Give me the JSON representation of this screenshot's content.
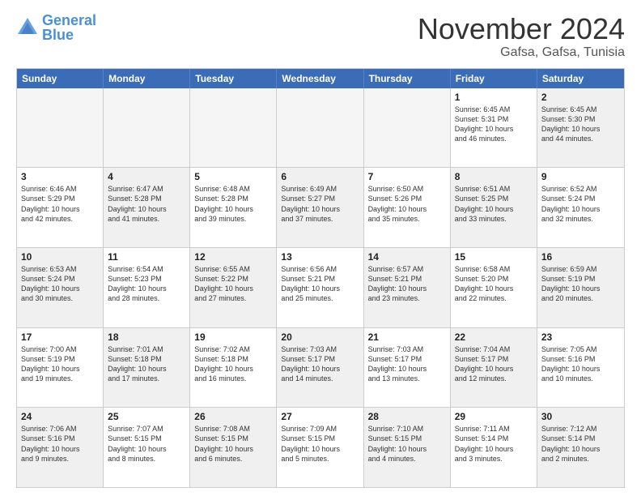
{
  "logo": {
    "line1": "General",
    "line2": "Blue"
  },
  "title": "November 2024",
  "location": "Gafsa, Gafsa, Tunisia",
  "days_of_week": [
    "Sunday",
    "Monday",
    "Tuesday",
    "Wednesday",
    "Thursday",
    "Friday",
    "Saturday"
  ],
  "rows": [
    [
      {
        "day": "",
        "empty": true
      },
      {
        "day": "",
        "empty": true
      },
      {
        "day": "",
        "empty": true
      },
      {
        "day": "",
        "empty": true
      },
      {
        "day": "",
        "empty": true
      },
      {
        "day": "1",
        "info": "Sunrise: 6:45 AM\nSunset: 5:31 PM\nDaylight: 10 hours\nand 46 minutes."
      },
      {
        "day": "2",
        "info": "Sunrise: 6:45 AM\nSunset: 5:30 PM\nDaylight: 10 hours\nand 44 minutes.",
        "shaded": true
      }
    ],
    [
      {
        "day": "3",
        "info": "Sunrise: 6:46 AM\nSunset: 5:29 PM\nDaylight: 10 hours\nand 42 minutes."
      },
      {
        "day": "4",
        "info": "Sunrise: 6:47 AM\nSunset: 5:28 PM\nDaylight: 10 hours\nand 41 minutes.",
        "shaded": true
      },
      {
        "day": "5",
        "info": "Sunrise: 6:48 AM\nSunset: 5:28 PM\nDaylight: 10 hours\nand 39 minutes."
      },
      {
        "day": "6",
        "info": "Sunrise: 6:49 AM\nSunset: 5:27 PM\nDaylight: 10 hours\nand 37 minutes.",
        "shaded": true
      },
      {
        "day": "7",
        "info": "Sunrise: 6:50 AM\nSunset: 5:26 PM\nDaylight: 10 hours\nand 35 minutes."
      },
      {
        "day": "8",
        "info": "Sunrise: 6:51 AM\nSunset: 5:25 PM\nDaylight: 10 hours\nand 33 minutes.",
        "shaded": true
      },
      {
        "day": "9",
        "info": "Sunrise: 6:52 AM\nSunset: 5:24 PM\nDaylight: 10 hours\nand 32 minutes."
      }
    ],
    [
      {
        "day": "10",
        "info": "Sunrise: 6:53 AM\nSunset: 5:24 PM\nDaylight: 10 hours\nand 30 minutes.",
        "shaded": true
      },
      {
        "day": "11",
        "info": "Sunrise: 6:54 AM\nSunset: 5:23 PM\nDaylight: 10 hours\nand 28 minutes."
      },
      {
        "day": "12",
        "info": "Sunrise: 6:55 AM\nSunset: 5:22 PM\nDaylight: 10 hours\nand 27 minutes.",
        "shaded": true
      },
      {
        "day": "13",
        "info": "Sunrise: 6:56 AM\nSunset: 5:21 PM\nDaylight: 10 hours\nand 25 minutes."
      },
      {
        "day": "14",
        "info": "Sunrise: 6:57 AM\nSunset: 5:21 PM\nDaylight: 10 hours\nand 23 minutes.",
        "shaded": true
      },
      {
        "day": "15",
        "info": "Sunrise: 6:58 AM\nSunset: 5:20 PM\nDaylight: 10 hours\nand 22 minutes."
      },
      {
        "day": "16",
        "info": "Sunrise: 6:59 AM\nSunset: 5:19 PM\nDaylight: 10 hours\nand 20 minutes.",
        "shaded": true
      }
    ],
    [
      {
        "day": "17",
        "info": "Sunrise: 7:00 AM\nSunset: 5:19 PM\nDaylight: 10 hours\nand 19 minutes."
      },
      {
        "day": "18",
        "info": "Sunrise: 7:01 AM\nSunset: 5:18 PM\nDaylight: 10 hours\nand 17 minutes.",
        "shaded": true
      },
      {
        "day": "19",
        "info": "Sunrise: 7:02 AM\nSunset: 5:18 PM\nDaylight: 10 hours\nand 16 minutes."
      },
      {
        "day": "20",
        "info": "Sunrise: 7:03 AM\nSunset: 5:17 PM\nDaylight: 10 hours\nand 14 minutes.",
        "shaded": true
      },
      {
        "day": "21",
        "info": "Sunrise: 7:03 AM\nSunset: 5:17 PM\nDaylight: 10 hours\nand 13 minutes."
      },
      {
        "day": "22",
        "info": "Sunrise: 7:04 AM\nSunset: 5:17 PM\nDaylight: 10 hours\nand 12 minutes.",
        "shaded": true
      },
      {
        "day": "23",
        "info": "Sunrise: 7:05 AM\nSunset: 5:16 PM\nDaylight: 10 hours\nand 10 minutes."
      }
    ],
    [
      {
        "day": "24",
        "info": "Sunrise: 7:06 AM\nSunset: 5:16 PM\nDaylight: 10 hours\nand 9 minutes.",
        "shaded": true
      },
      {
        "day": "25",
        "info": "Sunrise: 7:07 AM\nSunset: 5:15 PM\nDaylight: 10 hours\nand 8 minutes."
      },
      {
        "day": "26",
        "info": "Sunrise: 7:08 AM\nSunset: 5:15 PM\nDaylight: 10 hours\nand 6 minutes.",
        "shaded": true
      },
      {
        "day": "27",
        "info": "Sunrise: 7:09 AM\nSunset: 5:15 PM\nDaylight: 10 hours\nand 5 minutes."
      },
      {
        "day": "28",
        "info": "Sunrise: 7:10 AM\nSunset: 5:15 PM\nDaylight: 10 hours\nand 4 minutes.",
        "shaded": true
      },
      {
        "day": "29",
        "info": "Sunrise: 7:11 AM\nSunset: 5:14 PM\nDaylight: 10 hours\nand 3 minutes."
      },
      {
        "day": "30",
        "info": "Sunrise: 7:12 AM\nSunset: 5:14 PM\nDaylight: 10 hours\nand 2 minutes.",
        "shaded": true
      }
    ]
  ]
}
